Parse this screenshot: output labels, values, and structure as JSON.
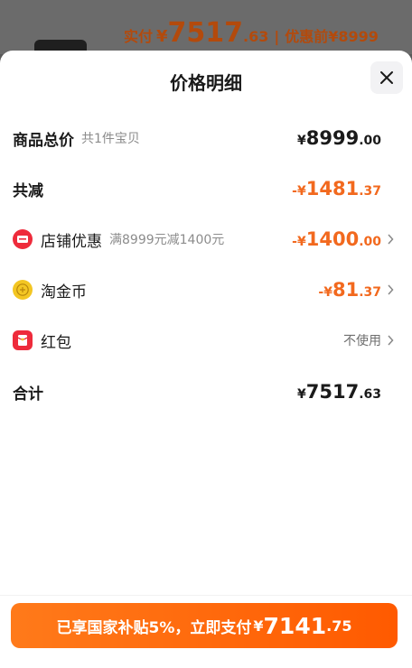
{
  "background": {
    "paid_label": "实付",
    "paid_currency": "¥",
    "paid_int": "7517",
    "paid_dec": ".63",
    "separator": "|",
    "before_label": "优惠前",
    "before_value": "¥8999"
  },
  "sheet": {
    "title": "价格明细",
    "close_icon": "close-icon"
  },
  "rows": {
    "total_goods": {
      "label": "商品总价",
      "sub": "共1件宝贝",
      "currency": "¥",
      "int": "8999",
      "dec": ".00"
    },
    "total_discount": {
      "label": "共减",
      "currency": "-¥",
      "int": "1481",
      "dec": ".37"
    },
    "shop_discount": {
      "label": "店铺优惠",
      "sub": "满8999元减1400元",
      "currency": "-¥",
      "int": "1400",
      "dec": ".00",
      "icon": "shop-coupon-icon"
    },
    "taojinbi": {
      "label": "淘金币",
      "currency": "-¥",
      "int": "81",
      "dec": ".37",
      "icon": "gold-coin-icon"
    },
    "red_packet": {
      "label": "红包",
      "status": "不使用",
      "icon": "red-packet-icon"
    },
    "grand_total": {
      "label": "合计",
      "currency": "¥",
      "int": "7517",
      "dec": ".63"
    }
  },
  "footer": {
    "button_text": "已享国家补贴5%，立即支付",
    "currency": "¥",
    "int": "7141",
    "dec": ".75"
  },
  "colors": {
    "accent_orange": "#f2691e",
    "button_orange": "#ff6a0a",
    "shop_red": "#ee2b3b",
    "coin_yellow": "#f3c623"
  }
}
